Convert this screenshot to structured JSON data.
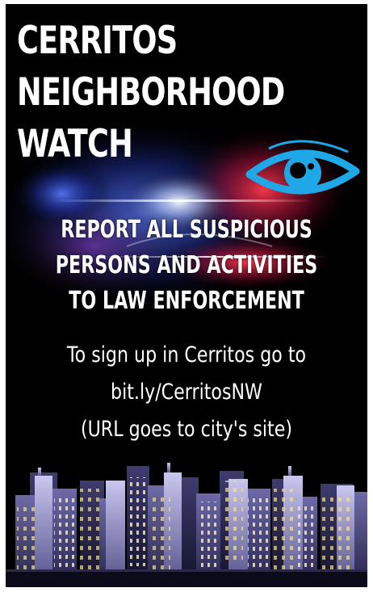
{
  "title": {
    "line1": "CERRITOS",
    "line2": "NEIGHBORHOOD",
    "line3": "WATCH"
  },
  "eye_icon": "eye-icon",
  "warning": {
    "line1": "REPORT ALL SUSPICIOUS",
    "line2": "PERSONS AND ACTIVITIES",
    "line3": "TO LAW ENFORCEMENT"
  },
  "signup": {
    "line1": "To sign up in Cerritos go to",
    "line2": "bit.ly/CerritosNW",
    "line3": "(URL goes to city's site)"
  },
  "colors": {
    "background": "#000000",
    "text": "#ffffff",
    "eye": "#1fa8e8",
    "police_red": "#e8203c",
    "police_blue": "#3a5cff",
    "buildings": "#3b3a66",
    "windows": "#ffe89a"
  }
}
